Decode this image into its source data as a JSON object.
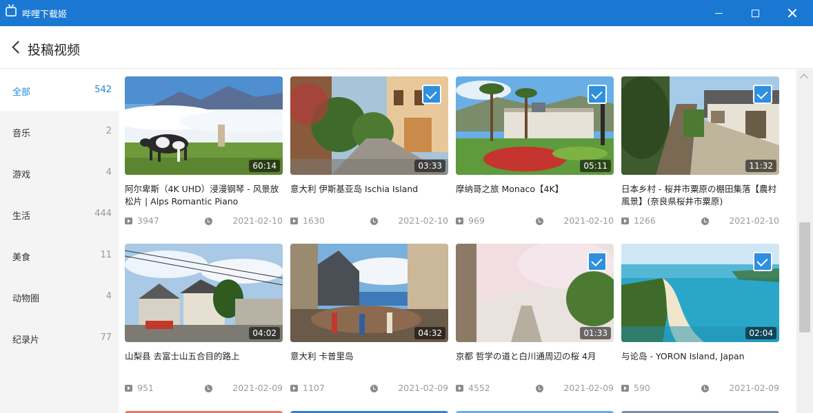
{
  "window": {
    "title": "哔哩下载姬",
    "icon": "tv-icon"
  },
  "header": {
    "back_icon": "chevron-left-icon",
    "title": "投稿视频"
  },
  "sidebar": {
    "items": [
      {
        "label": "全部",
        "count": "542",
        "active": true
      },
      {
        "label": "音乐",
        "count": "2",
        "active": false
      },
      {
        "label": "游戏",
        "count": "4",
        "active": false
      },
      {
        "label": "生活",
        "count": "444",
        "active": false
      },
      {
        "label": "美食",
        "count": "11",
        "active": false
      },
      {
        "label": "动物圈",
        "count": "4",
        "active": false
      },
      {
        "label": "纪录片",
        "count": "77",
        "active": false
      }
    ]
  },
  "videos": [
    {
      "title": "阿尔卑斯（4K UHD）浸漫钢琴 - 风景放松片 | Alps Romantic Piano",
      "duration": "60:14",
      "views": "3947",
      "date": "2021-02-10",
      "checked": false
    },
    {
      "title": "意大利 伊斯基亚岛 Ischia Island",
      "duration": "03:33",
      "views": "1630",
      "date": "2021-02-10",
      "checked": true
    },
    {
      "title": "摩纳哥之旅 Monaco【4K】",
      "duration": "05:11",
      "views": "969",
      "date": "2021-02-10",
      "checked": true
    },
    {
      "title": "日本乡村 - 桜井市粟原の棚田集落【農村風景】(奈良県桜井市粟原)",
      "duration": "11:32",
      "views": "1266",
      "date": "2021-02-10",
      "checked": true
    },
    {
      "title": "山梨县 去富士山五合目的路上",
      "duration": "04:02",
      "views": "951",
      "date": "2021-02-09",
      "checked": false
    },
    {
      "title": "意大利 卡普里岛",
      "duration": "04:32",
      "views": "1107",
      "date": "2021-02-09",
      "checked": false
    },
    {
      "title": "京都 哲学の道と白川通周辺の桜 4月",
      "duration": "01:33",
      "views": "4552",
      "date": "2021-02-09",
      "checked": true
    },
    {
      "title": "与论岛 - YORON Island, Japan",
      "duration": "02:04",
      "views": "590",
      "date": "2021-02-09",
      "checked": true
    }
  ],
  "colors": {
    "titlebar": "#1a78d2",
    "accent": "#1a8ad8",
    "check": "#2f8fe0",
    "sidebar_bg": "#f4f4f4"
  }
}
